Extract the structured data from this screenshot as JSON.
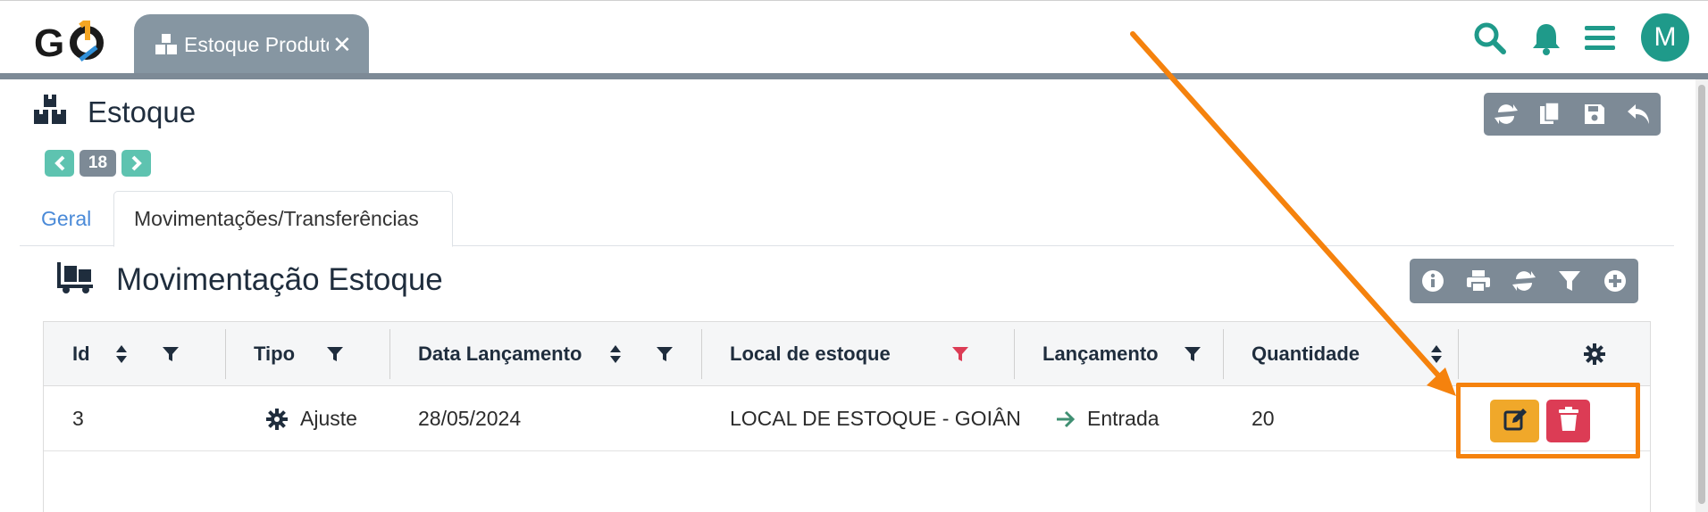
{
  "app": {
    "logo_text": "GO",
    "open_tab_label": "Estoque Produto",
    "close_glyph": "✕",
    "avatar_initial": "M",
    "icons": [
      "search-icon",
      "bell-icon",
      "menu-icon"
    ],
    "colors": {
      "accent": "#1f9a8a",
      "bar": "#7d8a96",
      "pager": "#5ec3b0",
      "highlight": "#f5820d",
      "edit": "#f0a82a",
      "delete": "#dc3c55"
    }
  },
  "page": {
    "title": "Estoque",
    "record_count": "18",
    "toolbar_icons": [
      "refresh-icon",
      "copy-icon",
      "save-icon",
      "undo-icon"
    ]
  },
  "tabs": [
    "Geral",
    "Movimentações/Transferências"
  ],
  "section": {
    "title": "Movimentação Estoque",
    "toolbar_icons": [
      "info-icon",
      "print-icon",
      "refresh-icon",
      "filter-icon",
      "add-icon"
    ]
  },
  "table": {
    "columns": [
      "Id",
      "Tipo",
      "Data Lançamento",
      "Local de estoque",
      "Lançamento",
      "Quantidade"
    ],
    "rows": [
      {
        "id": "3",
        "tipo": "Ajuste",
        "data": "28/05/2024",
        "local": "LOCAL DE ESTOQUE - GOIÂN",
        "lancamento": "Entrada",
        "quantidade": "20"
      }
    ],
    "row_actions": [
      "edit-icon",
      "trash-icon"
    ]
  }
}
